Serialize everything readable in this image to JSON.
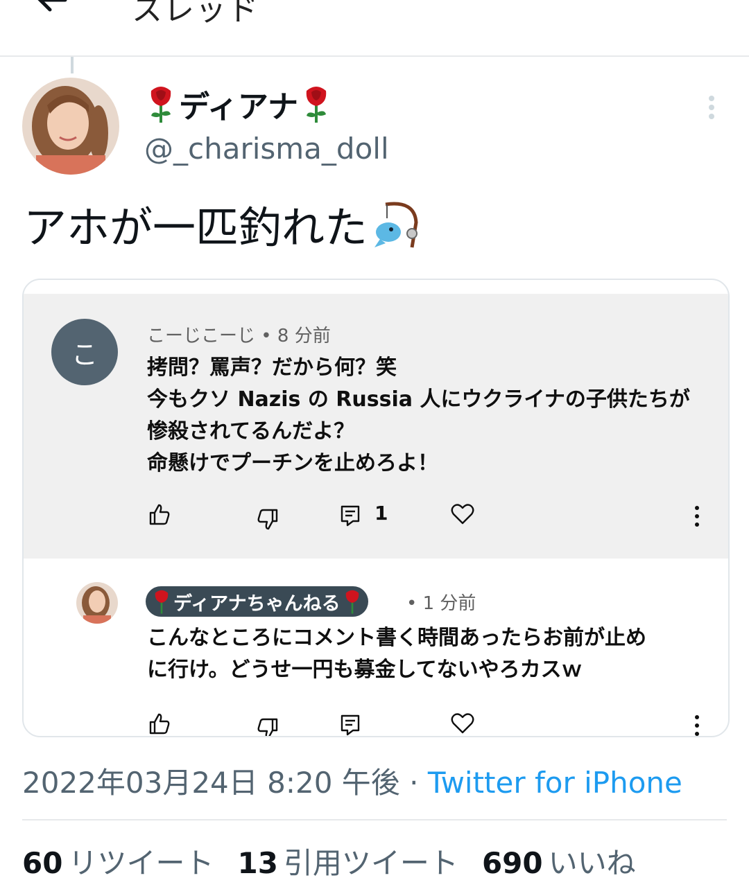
{
  "header": {
    "title": "スレッド"
  },
  "tweet": {
    "display_name": "ディアナ",
    "handle": "@_charisma_doll",
    "text": "アホが一匹釣れた",
    "timestamp": "2022年03月24日 8:20 午後",
    "separator": " · ",
    "source": "Twitter for iPhone",
    "stats": {
      "retweets": "60",
      "retweets_label": "リツイート",
      "quotes": "13",
      "quotes_label": "引用ツイート",
      "likes": "690",
      "likes_label": "いいね"
    }
  },
  "embedded": {
    "comment": {
      "avatar_letter": "こ",
      "author": "こーじこーじ",
      "time": "• 8 分前",
      "lines": [
        "拷問？罵声？だから何？笑",
        "今もクソ Nazis の Russia 人にウクライナの子供たちが",
        "惨殺されてるんだよ？",
        "命懸けでプーチンを止めろよ！"
      ],
      "reply_count": "1"
    },
    "reply": {
      "author": "ディアナちゃんねる",
      "time": "• 1 分前",
      "lines": [
        "こんなところにコメント書く時間あったらお前が止め",
        "に行け。どうせ一円も募金してないやろカスｗ"
      ]
    }
  },
  "colors": {
    "accent": "#1d9bf0",
    "muted": "#536471",
    "comment_bg": "#f0f0f0",
    "rose": "#d0141e"
  }
}
